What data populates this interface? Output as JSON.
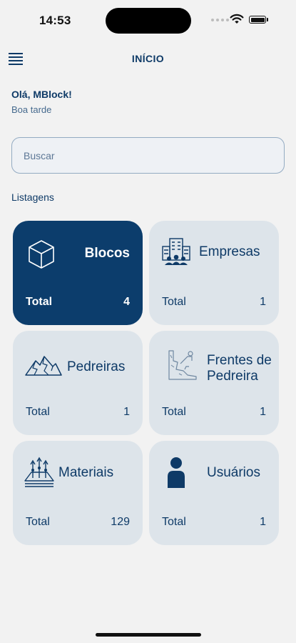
{
  "status_bar": {
    "time": "14:53"
  },
  "header": {
    "title": "INÍCIO",
    "menu_icon": "menu-icon"
  },
  "greeting": {
    "title": "Olá, MBlock!",
    "subtitle": "Boa tarde"
  },
  "search": {
    "placeholder": "Buscar",
    "value": ""
  },
  "section": {
    "label": "Listagens"
  },
  "cards": [
    {
      "title": "Blocos",
      "total_label": "Total",
      "total_value": "4",
      "icon": "cube-icon",
      "selected": true
    },
    {
      "title": "Empresas",
      "total_label": "Total",
      "total_value": "1",
      "icon": "building-people-icon",
      "selected": false
    },
    {
      "title": "Pedreiras",
      "total_label": "Total",
      "total_value": "1",
      "icon": "mountain-icon",
      "selected": false
    },
    {
      "title_line1": "Frentes de",
      "title_line2": "Pedreira",
      "total_label": "Total",
      "total_value": "1",
      "icon": "quarry-excavation-icon",
      "selected": false
    },
    {
      "title": "Materiais",
      "total_label": "Total",
      "total_value": "129",
      "icon": "material-layers-icon",
      "selected": false
    },
    {
      "title": "Usuários",
      "total_label": "Total",
      "total_value": "1",
      "icon": "user-icon",
      "selected": false
    }
  ],
  "colors": {
    "primary": "#0c3d6c",
    "card_bg": "#dde4ea",
    "background": "#f2f2f2",
    "text": "#0e3a67"
  }
}
